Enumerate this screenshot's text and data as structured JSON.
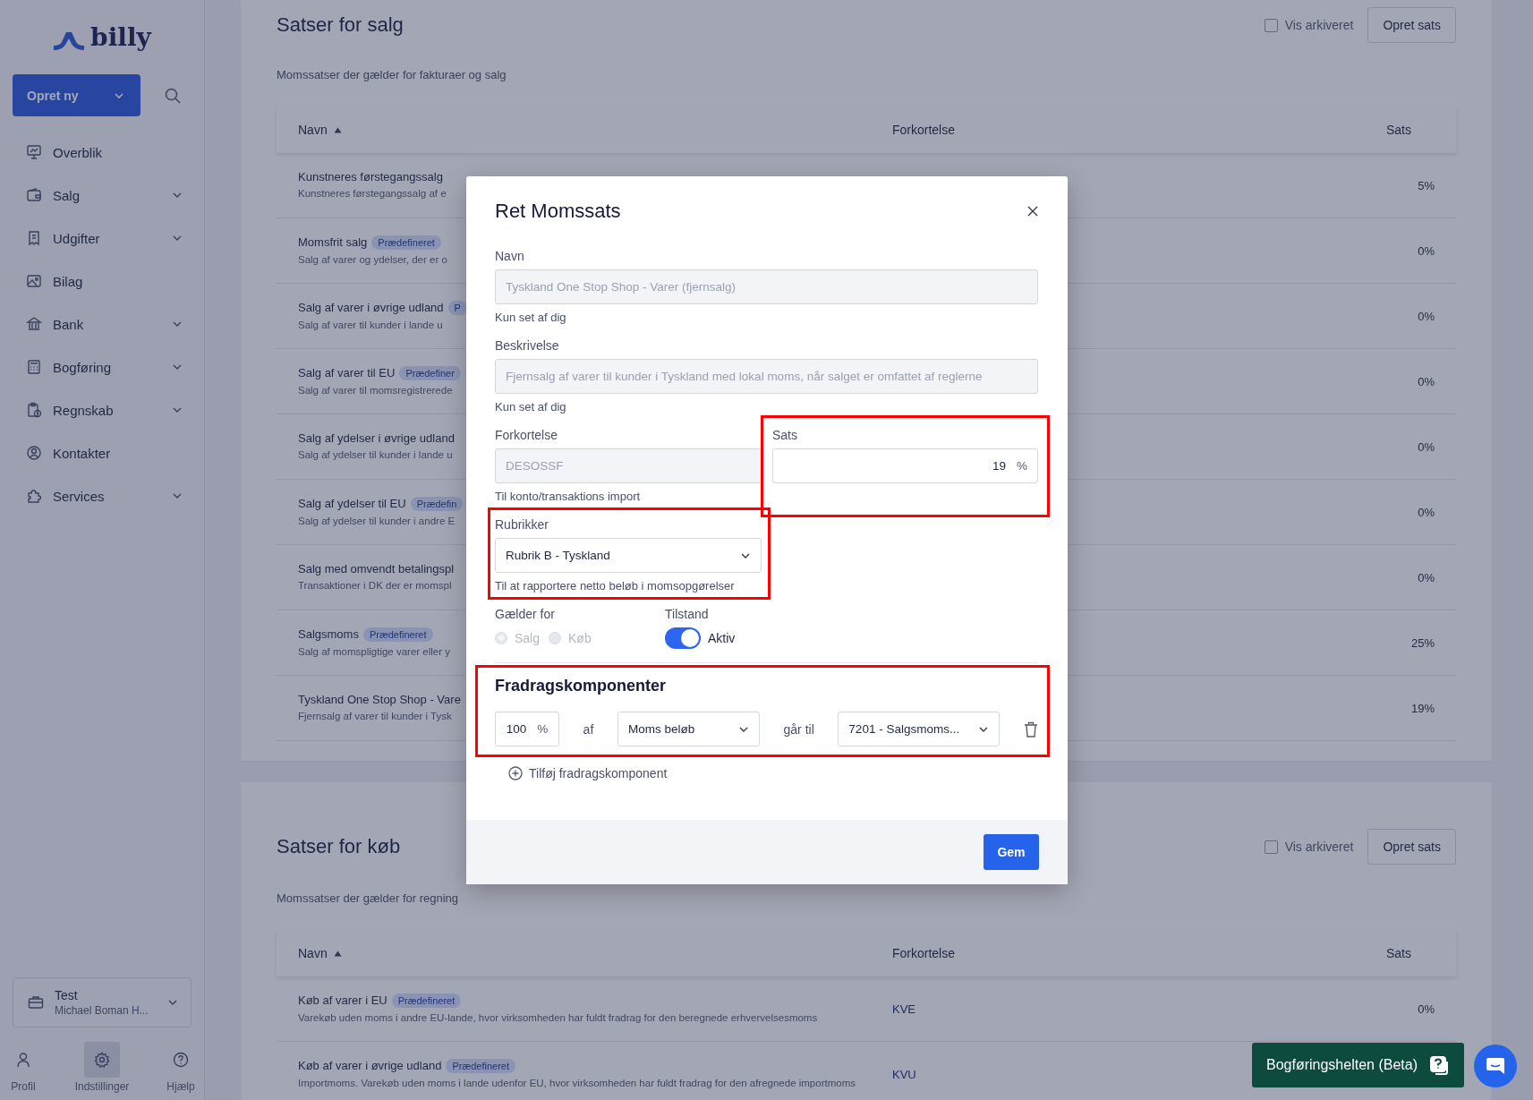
{
  "sidebar": {
    "logo": "billy",
    "create_button": "Opret ny",
    "items": [
      {
        "label": "Overblik",
        "expandable": false
      },
      {
        "label": "Salg",
        "expandable": true
      },
      {
        "label": "Udgifter",
        "expandable": true
      },
      {
        "label": "Bilag",
        "expandable": false
      },
      {
        "label": "Bank",
        "expandable": true
      },
      {
        "label": "Bogføring",
        "expandable": true
      },
      {
        "label": "Regnskab",
        "expandable": true
      },
      {
        "label": "Kontakter",
        "expandable": false
      },
      {
        "label": "Services",
        "expandable": true
      }
    ],
    "company": {
      "name": "Test",
      "owner": "Michael Boman H..."
    },
    "bottom_nav": [
      {
        "label": "Profil",
        "selected": false
      },
      {
        "label": "Indstillinger",
        "selected": true
      },
      {
        "label": "Hjælp",
        "selected": false
      }
    ]
  },
  "sections": [
    {
      "title": "Satser for salg",
      "subtitle": "Momssatser der gælder for fakturaer og salg",
      "show_archived": {
        "label": "Vis arkiveret",
        "checked": false
      },
      "create_button": "Opret sats",
      "columns": [
        "Navn",
        "Forkortelse",
        "Sats"
      ],
      "rows": [
        {
          "name": "Kunstneres førstegangssalg",
          "description": "Kunstneres førstegangssalg af e",
          "rate": "5%"
        },
        {
          "name": "Momsfrit salg",
          "badge": "Prædefineret",
          "description": "Salg af varer og ydelser, der er o",
          "rate": "0%"
        },
        {
          "name": "Salg af varer i øvrige udland",
          "badge": "P",
          "description": "Salg af varer til kunder i lande u",
          "rate": "0%"
        },
        {
          "name": "Salg af varer til EU",
          "badge": "Prædefiner",
          "description": "Salg af varer til momsregistrerede",
          "rate": "0%"
        },
        {
          "name": "Salg af ydelser i øvrige udland",
          "description": "Salg af ydelser til kunder i lande u",
          "rate": "0%"
        },
        {
          "name": "Salg af ydelser til EU",
          "badge": "Prædefin",
          "description": "Salg af ydelser til kunder i andre E",
          "rate": "0%"
        },
        {
          "name": "Salg med omvendt betalingspl",
          "description": "Transaktioner i DK der er momspl",
          "rate": "0%"
        },
        {
          "name": "Salgsmoms",
          "badge": "Prædefineret",
          "description": "Salg af momspligtige varer eller y",
          "rate": "25%"
        },
        {
          "name": "Tyskland One Stop Shop - Vare",
          "description": "Fjernsalg af varer til kunder i Tysk",
          "rate": "19%"
        }
      ]
    },
    {
      "title": "Satser for køb",
      "subtitle": "Momssatser der gælder for regning",
      "show_archived": {
        "label": "Vis arkiveret",
        "checked": false
      },
      "create_button": "Opret sats",
      "columns": [
        "Navn",
        "Forkortelse",
        "Sats"
      ],
      "rows": [
        {
          "name": "Køb af varer i EU",
          "badge": "Prædefineret",
          "description": "Varekøb uden moms i andre EU-lande, hvor virksomheden har fuldt fradrag for den beregnede erhvervelsesmoms",
          "abbreviation": "KVE",
          "rate": "0%"
        },
        {
          "name": "Køb af varer i øvrige udland",
          "badge": "Prædefineret",
          "description": "Importmoms. Varekøb uden moms i lande udenfor EU, hvor virksomheden har fuldt fradrag for den afregnede importmoms",
          "abbreviation": "KVU"
        }
      ]
    }
  ],
  "modal": {
    "title": "Ret Momssats",
    "name": {
      "label": "Navn",
      "value": "Tyskland One Stop Shop - Varer (fjernsalg)",
      "hint": "Kun set af dig",
      "disabled": true
    },
    "description": {
      "label": "Beskrivelse",
      "value": "Fjernsalg af varer til kunder i Tyskland med lokal moms, når salget er omfattet af reglerne",
      "hint": "Kun set af dig",
      "disabled": true
    },
    "abbreviation": {
      "label": "Forkortelse",
      "value": "DESOSSF",
      "hint": "Til konto/transaktions import",
      "disabled": true
    },
    "rate": {
      "label": "Sats",
      "value": "19",
      "unit": "%",
      "highlighted": true
    },
    "boxes": {
      "label": "Rubrikker",
      "value": "Rubrik B - Tyskland",
      "hint": "Til at rapportere netto beløb i momsopgørelser",
      "highlighted": true
    },
    "applies_to": {
      "label": "Gælder for",
      "disabled": true,
      "options": [
        {
          "label": "Salg",
          "selected": true
        },
        {
          "label": "Køb",
          "selected": false
        }
      ]
    },
    "status": {
      "label": "Tilstand",
      "on": true,
      "text": "Aktiv"
    },
    "deductions": {
      "title": "Fradragskomponenter",
      "highlighted": true,
      "rows": [
        {
          "percent": "100",
          "unit": "%",
          "of_label": "af",
          "base": "Moms beløb",
          "to_label": "går til",
          "account": "7201 -  Salgsmoms..."
        }
      ],
      "add_link": "Tilføj fradragskomponent"
    },
    "save_button": "Gem"
  },
  "helper_button": "Bogføringshelten (Beta)"
}
